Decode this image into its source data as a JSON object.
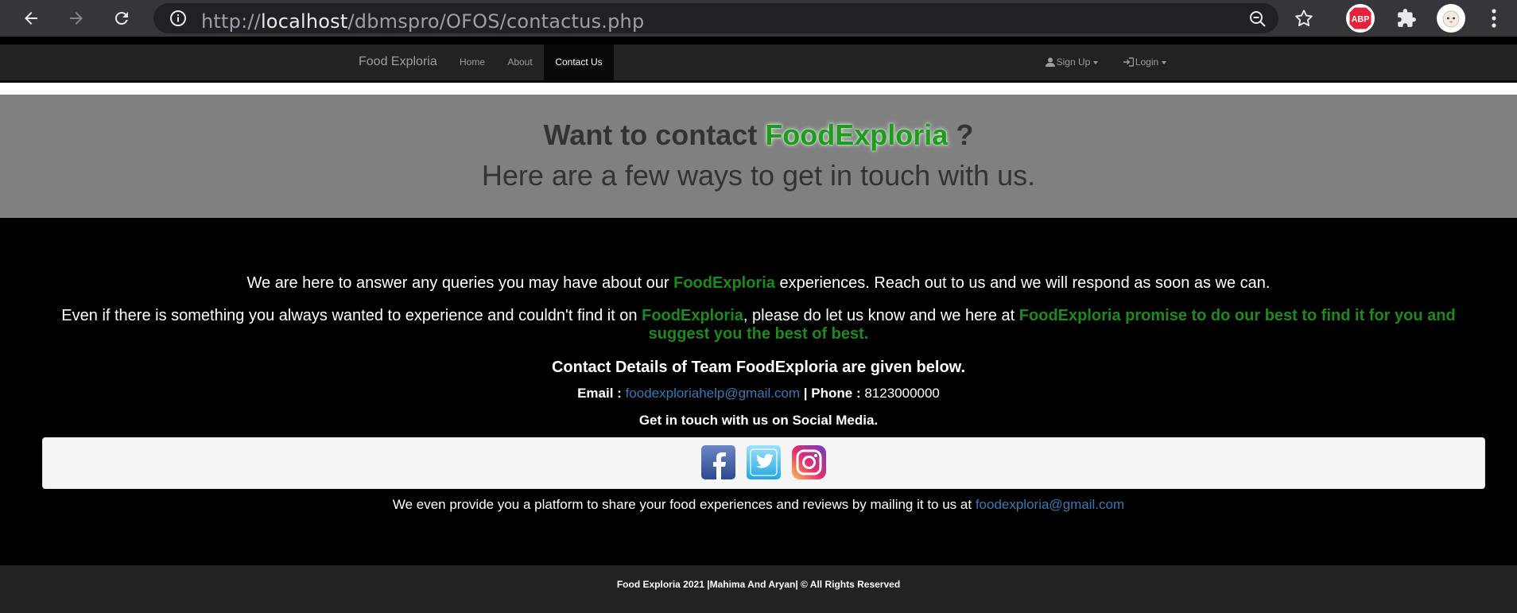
{
  "browser": {
    "url_scheme": "http://",
    "url_host": "localhost",
    "url_path": "/dbmspro/OFOS/contactus.php",
    "extensions": [
      "adblock-plus-icon",
      "puzzle-extensions-icon",
      "profile-avatar"
    ]
  },
  "navbar": {
    "brand": "Food Exploria",
    "items": [
      {
        "label": "Home"
      },
      {
        "label": "About"
      },
      {
        "label": "Contact Us"
      }
    ],
    "signup": "Sign Up",
    "login": "Login"
  },
  "jumbotron": {
    "title_prefix": "Want to contact ",
    "title_brand": "FoodExploria",
    "title_suffix": " ?",
    "subtitle": "Here are a few ways to get in touch with us."
  },
  "content": {
    "p1_a": "We are here to answer any queries you may have about our ",
    "p1_brand": "FoodExploria",
    "p1_b": " experiences. Reach out to us and we will respond as soon as we can.",
    "p2_a": "Even if there is something you always wanted to experience and couldn't find it on ",
    "p2_brand": "FoodExploria",
    "p2_b": ", please do let us know and we here at ",
    "p2_green": "FoodExploria promise to do our best to find it for you and suggest you the best of best.",
    "contact_heading": "Contact Details of Team FoodExploria are given below.",
    "email_label": "Email :",
    "email": "foodexploriahelp@gmail.com",
    "phone_label": "| Phone :",
    "phone": "8123000000",
    "social_heading": "Get in touch with us on Social Media.",
    "platform_text": "We even provide you a platform to share your food experiences and reviews by mailing it to us at ",
    "platform_email": "foodexploria@gmail.com"
  },
  "footer": {
    "text": "Food Exploria 2021 |Mahima And Aryan| © All Rights Reserved"
  },
  "colors": {
    "brand_green": "#1c8a1c",
    "link_blue": "#337ab7",
    "navbar_bg": "#222222",
    "jumbotron_bg": "#808080"
  }
}
